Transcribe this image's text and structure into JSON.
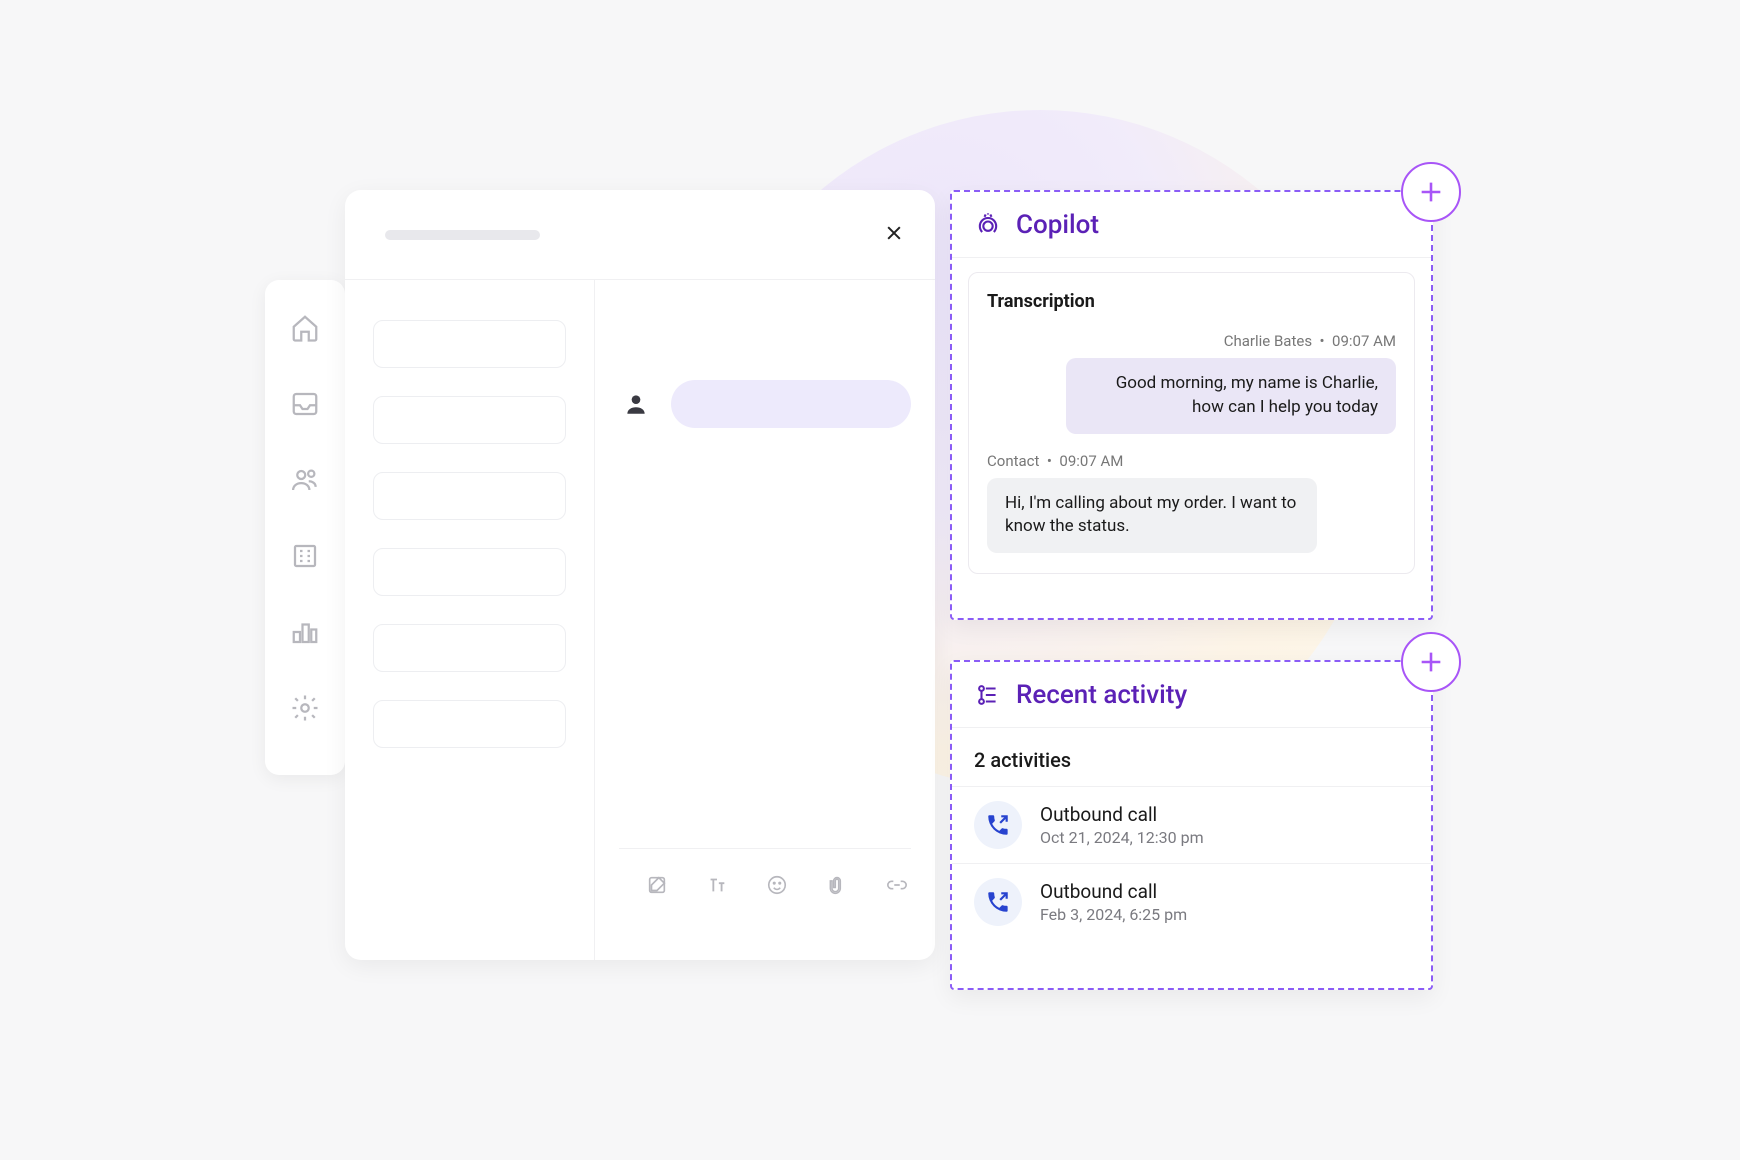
{
  "sidebar": {
    "items": [
      {
        "name": "home"
      },
      {
        "name": "inbox"
      },
      {
        "name": "contacts"
      },
      {
        "name": "companies"
      },
      {
        "name": "reports"
      },
      {
        "name": "settings"
      }
    ]
  },
  "copilot": {
    "title": "Copilot",
    "transcription_label": "Transcription",
    "messages": [
      {
        "side": "agent",
        "author": "Charlie Bates",
        "time": "09:07 AM",
        "text": "Good morning, my name is Charlie, how can I help you today"
      },
      {
        "side": "contact",
        "author": "Contact",
        "time": "09:07 AM",
        "text": "Hi, I'm calling about my order. I want to know the status."
      }
    ]
  },
  "recent_activity": {
    "title": "Recent activity",
    "count_label": "2 activities",
    "items": [
      {
        "title": "Outbound call",
        "subtitle": "Oct 21, 2024, 12:30 pm"
      },
      {
        "title": "Outbound call",
        "subtitle": "Feb 3, 2024, 6:25 pm"
      }
    ]
  },
  "colors": {
    "accent": "#5b21b6",
    "plus_border": "#a855f7",
    "agent_bubble": "#eae6f6",
    "contact_bubble": "#f0f1f3"
  }
}
